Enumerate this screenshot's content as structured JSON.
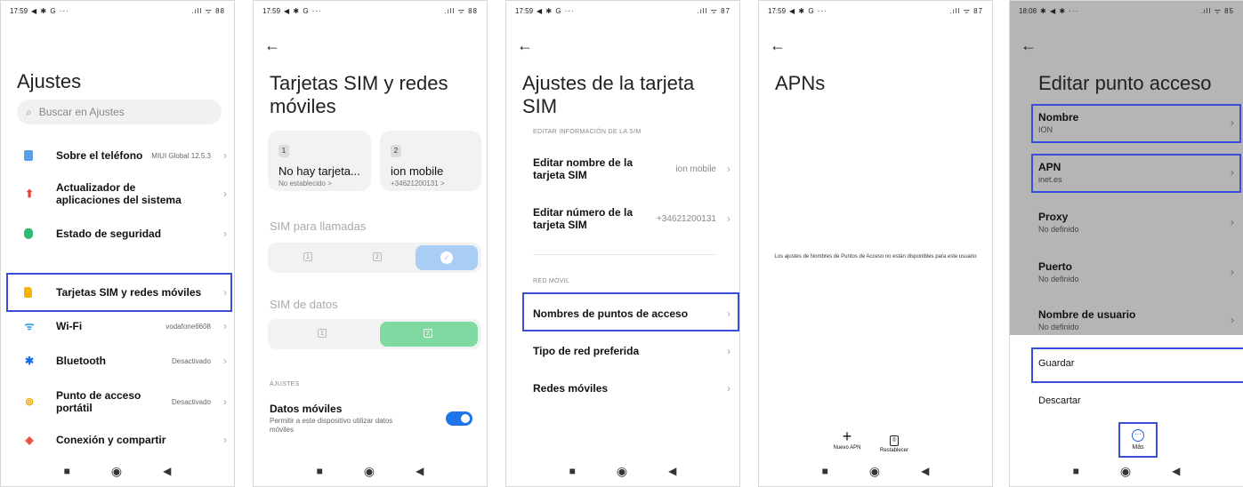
{
  "panel1": {
    "status": {
      "time": "17:59",
      "icons": "◀ ✱ G ···",
      "right": ".ıll ᯤ 88"
    },
    "title": "Ajustes",
    "search_placeholder": "Buscar en Ajustes",
    "items": [
      {
        "label": "Sobre el teléfono",
        "value": "MIUI Global 12.5.3",
        "icon": "phone-info-icon",
        "color": "#5aa0e8"
      },
      {
        "label": "Actualizador de aplicaciones del sistema",
        "value": "",
        "icon": "update-arrow-icon",
        "color": "#e8453c"
      },
      {
        "label": "Estado de seguridad",
        "value": "",
        "icon": "shield-icon",
        "color": "#2eb872"
      },
      {
        "label": "Tarjetas SIM y redes móviles",
        "value": "",
        "icon": "sim-icon",
        "color": "#f5b400"
      },
      {
        "label": "Wi-Fi",
        "value": "vodafone6608",
        "icon": "wifi-icon",
        "color": "#1a9fe8"
      },
      {
        "label": "Bluetooth",
        "value": "Desactivado",
        "icon": "bluetooth-icon",
        "color": "#1a6fe8"
      },
      {
        "label": "Punto de acceso portátil",
        "value": "Desactivado",
        "icon": "hotspot-icon",
        "color": "#f5a800"
      },
      {
        "label": "Conexión y compartir",
        "value": "",
        "icon": "share-icon",
        "color": "#e8453c"
      }
    ]
  },
  "panel2": {
    "status": {
      "time": "17:59",
      "icons": "◀ ✱ G ···",
      "right": ".ıll ᯤ 88"
    },
    "title": "Tarjetas SIM y redes móviles",
    "sim1": {
      "slot": "1",
      "name": "No hay tarjeta...",
      "sub": "No establecido >"
    },
    "sim2": {
      "slot": "2",
      "name": "ion mobile",
      "sub": "+34621200131 >"
    },
    "calls_title": "SIM para llamadas",
    "calls_options": [
      "1",
      "2"
    ],
    "data_title": "SIM de datos",
    "data_options": [
      "1",
      "2"
    ],
    "settings_caps": "AJUSTES",
    "mobile_data": {
      "label": "Datos móviles",
      "desc": "Permitir a este dispositivo utilizar datos móviles"
    }
  },
  "panel3": {
    "status": {
      "time": "17:59",
      "icons": "◀ ✱ G ···",
      "right": ".ıll ᯤ 87"
    },
    "title": "Ajustes de la tarjeta SIM",
    "edit_caps": "EDITAR INFORMACIÓN DE LA SIM",
    "rows": [
      {
        "label": "Editar nombre de la tarjeta SIM",
        "value": "ion mobile"
      },
      {
        "label": "Editar número de la tarjeta SIM",
        "value": "+34621200131"
      }
    ],
    "network_caps": "RED MÓVIL",
    "network_rows": [
      {
        "label": "Nombres de puntos de acceso"
      },
      {
        "label": "Tipo de red preferida"
      },
      {
        "label": "Redes móviles"
      }
    ]
  },
  "panel4": {
    "status": {
      "time": "17:59",
      "icons": "◀ ✱ G ···",
      "right": ".ıll ᯤ 87"
    },
    "title": "APNs",
    "message": "Los ajustes de Nombres de Puntos de Acceso no están disponibles para este usuario",
    "new_apn": "Nuevo APN",
    "reset": "Restablecer"
  },
  "panel5": {
    "status": {
      "time": "18:08",
      "icons": "✱ ◀ ✱ ···",
      "right": ".ıll ᯤ 85"
    },
    "title": "Editar punto acceso",
    "fields": [
      {
        "key": "Nombre",
        "value": "ION"
      },
      {
        "key": "APN",
        "value": "inet.es"
      },
      {
        "key": "Proxy",
        "value": "No definido"
      },
      {
        "key": "Puerto",
        "value": "No definido"
      },
      {
        "key": "Nombre de usuario",
        "value": "No definido"
      }
    ],
    "save": "Guardar",
    "discard": "Descartar",
    "more": "Más"
  },
  "colors": {
    "highlight": "#3a4fd9",
    "accent": "#1e74e8",
    "sel_blue": "#a9cdf5",
    "sel_green": "#7fd9a0"
  }
}
